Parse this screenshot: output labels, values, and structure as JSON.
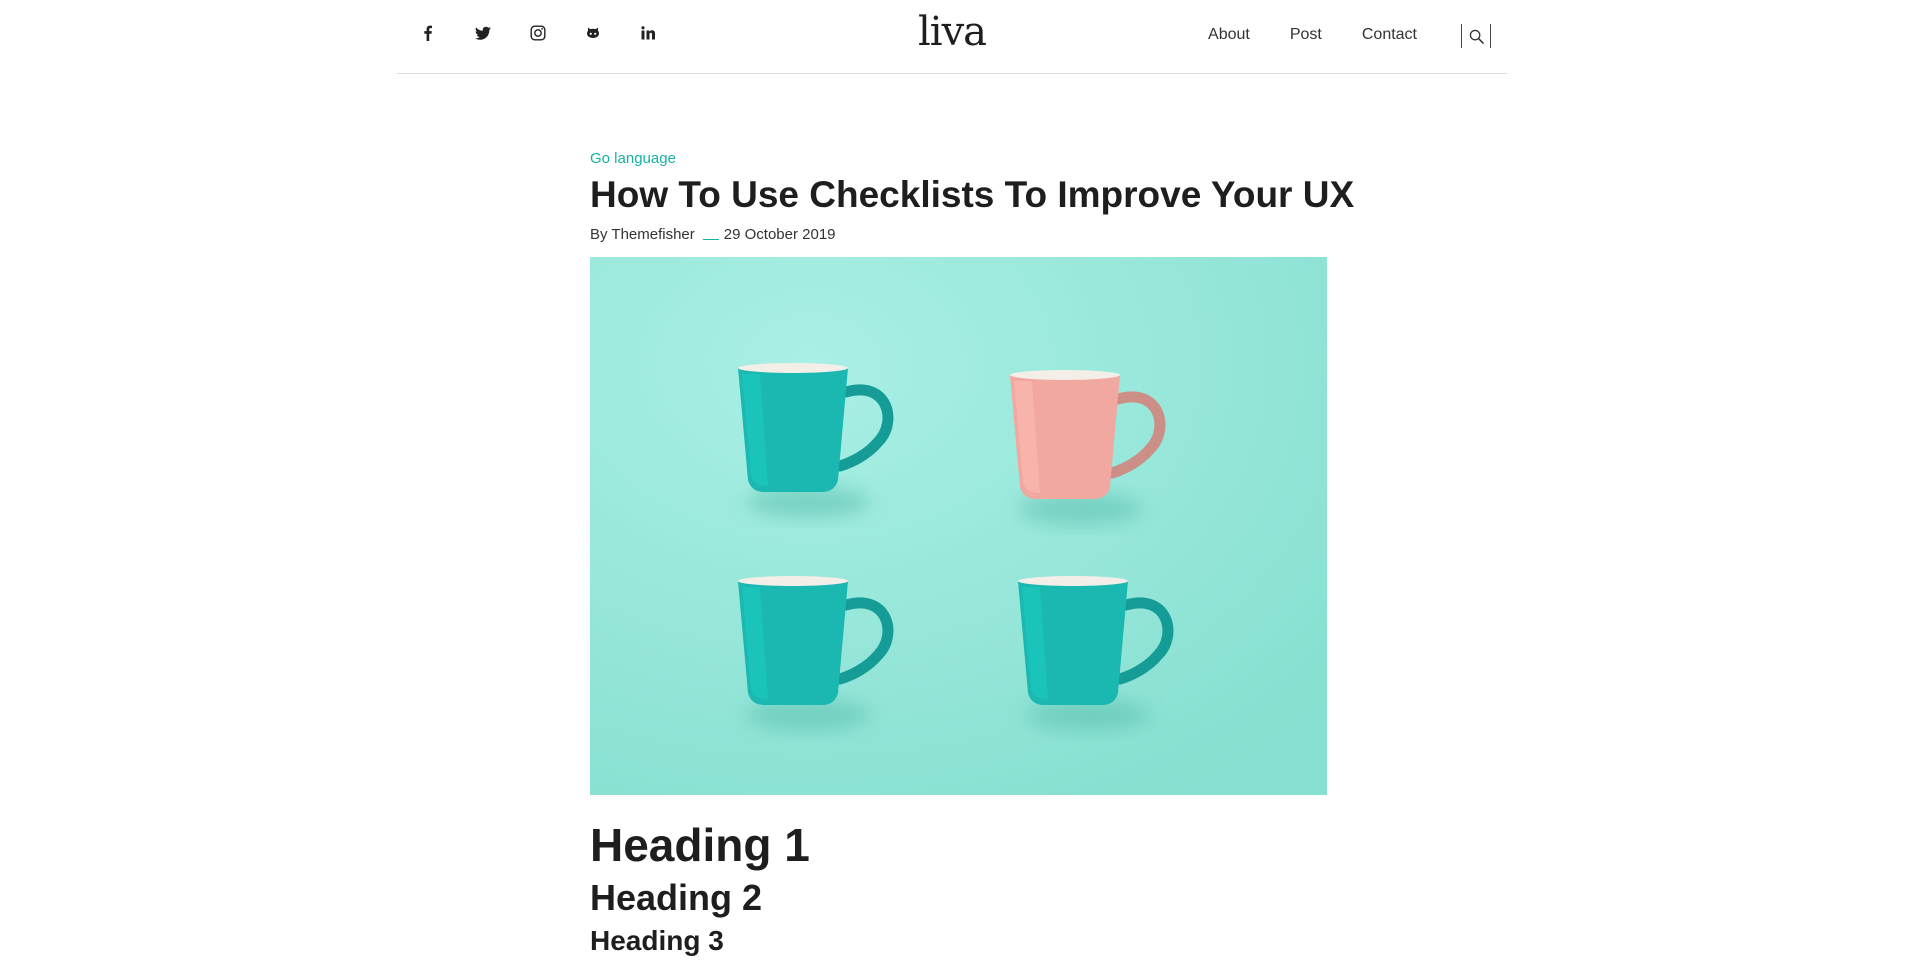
{
  "header": {
    "social_icons": [
      "facebook-icon",
      "twitter-icon",
      "instagram-icon",
      "github-icon",
      "linkedin-icon"
    ],
    "logo_text": "liva",
    "nav": [
      {
        "label": "About"
      },
      {
        "label": "Post"
      },
      {
        "label": "Contact"
      }
    ],
    "search_icon": "search-icon"
  },
  "article": {
    "category": "Go language",
    "title": "How To Use Checklists To Improve Your UX",
    "author": "By Themefisher",
    "date": "29 October 2019",
    "image": {
      "background_color": "#94e6d9",
      "mugs": [
        {
          "color": "#1ab8b0"
        },
        {
          "color": "#f0a8a0"
        },
        {
          "color": "#1ab8b0"
        },
        {
          "color": "#1ab8b0"
        }
      ]
    },
    "headings": {
      "h1": "Heading 1",
      "h2": "Heading 2",
      "h3": "Heading 3"
    }
  },
  "colors": {
    "accent": "#14b3a3",
    "text": "#1e1e1e",
    "divider": "#dcdcdc"
  }
}
